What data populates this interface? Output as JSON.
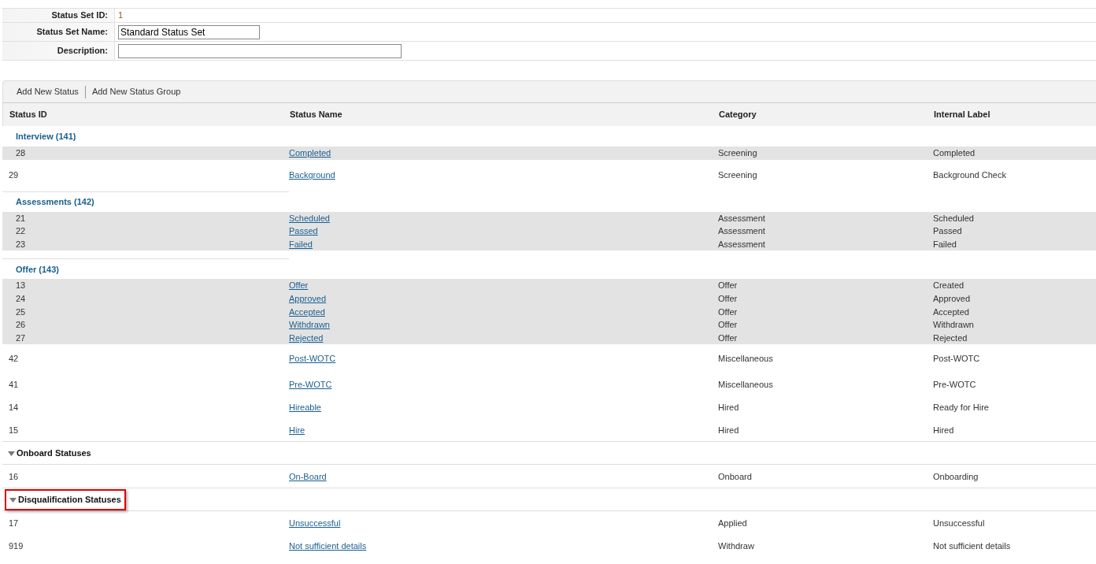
{
  "form": {
    "fields": [
      {
        "kind": "text",
        "label": "Status Set ID:",
        "value": "1"
      },
      {
        "kind": "short_input",
        "label": "Status Set Name:",
        "value": "Standard Status Set"
      },
      {
        "kind": "long_input",
        "label": "Description:"
      }
    ]
  },
  "toolbar": {
    "buttons": [
      "Add New Status",
      "Add New Status Group"
    ]
  },
  "table": {
    "columns": [
      "Status ID",
      "Status Name",
      "Category",
      "Internal Label"
    ],
    "items": [
      {
        "kind": "group",
        "label": "Interview (141)",
        "children": [
          {
            "id": "28",
            "name": "Completed",
            "category": "Screening",
            "internal_label": "Completed",
            "shaded": true
          },
          {
            "id": "29",
            "name": "Background",
            "category": "Screening",
            "internal_label": "Background Check",
            "shaded": false
          }
        ]
      },
      {
        "kind": "group",
        "label": "Assessments (142)",
        "children": [
          {
            "id": "21",
            "name": "Scheduled",
            "category": "Assessment",
            "internal_label": "Scheduled",
            "shaded": true
          },
          {
            "id": "22",
            "name": "Passed",
            "category": "Assessment",
            "internal_label": "Passed",
            "shaded": true
          },
          {
            "id": "23",
            "name": "Failed",
            "category": "Assessment",
            "internal_label": "Failed",
            "shaded": true
          }
        ]
      },
      {
        "kind": "group",
        "label": "Offer (143)",
        "children": [
          {
            "id": "13",
            "name": "Offer",
            "category": "Offer",
            "internal_label": "Created",
            "shaded": true
          },
          {
            "id": "24",
            "name": "Approved",
            "category": "Offer",
            "internal_label": "Approved",
            "shaded": true
          },
          {
            "id": "25",
            "name": "Accepted",
            "category": "Offer",
            "internal_label": "Accepted",
            "shaded": true
          },
          {
            "id": "26",
            "name": "Withdrawn",
            "category": "Offer",
            "internal_label": "Withdrawn",
            "shaded": true
          },
          {
            "id": "27",
            "name": "Rejected",
            "category": "Offer",
            "internal_label": "Rejected",
            "shaded": true
          }
        ]
      },
      {
        "kind": "status",
        "id": "42",
        "name": "Post-WOTC",
        "category": "Miscellaneous",
        "internal_label": "Post-WOTC",
        "shaded": false
      },
      {
        "kind": "status",
        "id": "41",
        "name": "Pre-WOTC",
        "category": "Miscellaneous",
        "internal_label": "Pre-WOTC",
        "shaded": false
      },
      {
        "kind": "status",
        "id": "14",
        "name": "Hireable",
        "category": "Hired",
        "internal_label": "Ready for Hire",
        "shaded": false
      },
      {
        "kind": "status",
        "id": "15",
        "name": "Hire",
        "category": "Hired",
        "internal_label": "Hired",
        "shaded": false
      },
      {
        "kind": "section",
        "label": "Onboard Statuses",
        "expanded": true,
        "highlighted": false,
        "children": [
          {
            "id": "16",
            "name": "On-Board",
            "category": "Onboard",
            "internal_label": "Onboarding",
            "shaded": false
          }
        ]
      },
      {
        "kind": "section",
        "label": "Disqualification Statuses",
        "expanded": true,
        "highlighted": true,
        "children": [
          {
            "id": "17",
            "name": "Unsuccessful",
            "category": "Applied",
            "internal_label": "Unsuccessful",
            "shaded": false
          },
          {
            "id": "919",
            "name": "Not sufficient details",
            "category": "Withdraw",
            "internal_label": "Not sufficient details",
            "shaded": false
          }
        ]
      }
    ]
  }
}
